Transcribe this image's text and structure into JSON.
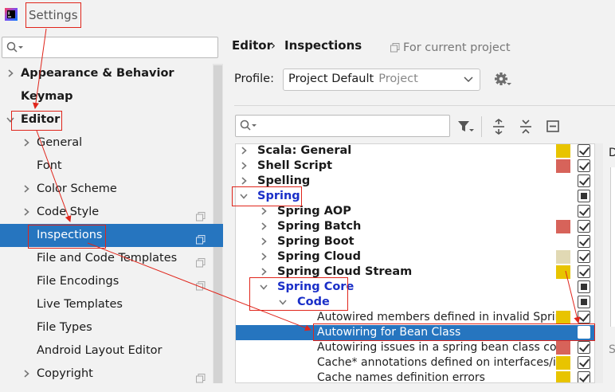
{
  "window": {
    "title": "Settings"
  },
  "sidebar": {
    "items": [
      {
        "label": "Appearance & Behavior",
        "expander": "collapsed",
        "bold": true,
        "indent": 0
      },
      {
        "label": "Keymap",
        "expander": "none",
        "bold": true,
        "indent": 0
      },
      {
        "label": "Editor",
        "expander": "expanded",
        "bold": true,
        "indent": 0
      },
      {
        "label": "General",
        "expander": "collapsed",
        "bold": false,
        "indent": 1
      },
      {
        "label": "Font",
        "expander": "none",
        "bold": false,
        "indent": 1
      },
      {
        "label": "Color Scheme",
        "expander": "collapsed",
        "bold": false,
        "indent": 1
      },
      {
        "label": "Code Style",
        "expander": "collapsed",
        "bold": false,
        "indent": 1,
        "project_icon": true
      },
      {
        "label": "Inspections",
        "expander": "none",
        "bold": false,
        "indent": 1,
        "selected": true,
        "project_icon": true
      },
      {
        "label": "File and Code Templates",
        "expander": "none",
        "bold": false,
        "indent": 1,
        "project_icon": true
      },
      {
        "label": "File Encodings",
        "expander": "none",
        "bold": false,
        "indent": 1,
        "project_icon": true
      },
      {
        "label": "Live Templates",
        "expander": "none",
        "bold": false,
        "indent": 1
      },
      {
        "label": "File Types",
        "expander": "none",
        "bold": false,
        "indent": 1
      },
      {
        "label": "Android Layout Editor",
        "expander": "none",
        "bold": false,
        "indent": 1
      },
      {
        "label": "Copyright",
        "expander": "collapsed",
        "bold": false,
        "indent": 1,
        "project_icon": true
      }
    ]
  },
  "breadcrumb": {
    "first": "Editor",
    "separator": "›",
    "second": "Inspections",
    "scope": "For current project"
  },
  "profile": {
    "label": "Profile:",
    "value": "Project Default",
    "scope": "Project"
  },
  "tree": {
    "rows": [
      {
        "label": "Scala: General",
        "expander": "collapsed",
        "bold": true,
        "indent": 0,
        "severity": "#e8c400",
        "check": "checked"
      },
      {
        "label": "Shell Script",
        "expander": "collapsed",
        "bold": true,
        "indent": 0,
        "severity": "#d7635a",
        "check": "checked"
      },
      {
        "label": "Spelling",
        "expander": "collapsed",
        "bold": true,
        "indent": 0,
        "severity": null,
        "check": "checked"
      },
      {
        "label": "Spring",
        "expander": "expanded",
        "bold": true,
        "blue": true,
        "indent": 0,
        "severity": null,
        "check": "partial"
      },
      {
        "label": "Spring AOP",
        "expander": "collapsed",
        "bold": true,
        "indent": 1,
        "severity": null,
        "check": "checked"
      },
      {
        "label": "Spring Batch",
        "expander": "collapsed",
        "bold": true,
        "indent": 1,
        "severity": "#d7635a",
        "check": "checked"
      },
      {
        "label": "Spring Boot",
        "expander": "collapsed",
        "bold": true,
        "indent": 1,
        "severity": null,
        "check": "checked"
      },
      {
        "label": "Spring Cloud",
        "expander": "collapsed",
        "bold": true,
        "indent": 1,
        "severity": "#e1d9b4",
        "check": "checked"
      },
      {
        "label": "Spring Cloud Stream",
        "expander": "collapsed",
        "bold": true,
        "indent": 1,
        "severity": "#e8c400",
        "check": "checked"
      },
      {
        "label": "Spring Core",
        "expander": "expanded",
        "bold": true,
        "blue": true,
        "indent": 1,
        "severity": null,
        "check": "partial"
      },
      {
        "label": "Code",
        "expander": "expanded",
        "bold": true,
        "blue": true,
        "indent": 2,
        "severity": null,
        "check": "partial"
      },
      {
        "label": "Autowired members defined in invalid Sprin",
        "expander": "none",
        "bold": false,
        "indent": 3,
        "severity": "#e8c400",
        "check": "checked"
      },
      {
        "label": "Autowiring for Bean Class",
        "expander": "none",
        "bold": false,
        "indent": 3,
        "severity": null,
        "check": "unchecked",
        "selected": true
      },
      {
        "label": "Autowiring issues in a spring bean class con",
        "expander": "none",
        "bold": false,
        "indent": 3,
        "severity": "#d7635a",
        "check": "checked"
      },
      {
        "label": "Cache* annotations defined on interfaces/in",
        "expander": "none",
        "bold": false,
        "indent": 3,
        "severity": "#e8c400",
        "check": "checked"
      },
      {
        "label": "Cache names definition errors",
        "expander": "none",
        "bold": false,
        "indent": 3,
        "severity": "#e8c400",
        "check": "checked"
      }
    ]
  },
  "description_pane": {
    "heading_letter": "D",
    "footer_letter": "S"
  },
  "colors": {
    "selection": "#2675bf",
    "annotation": "#e0251b",
    "group_label": "#1a2fc8"
  },
  "icons": {
    "app": "intellij-idea-icon",
    "search": "search-icon",
    "settings": "gear-icon",
    "filter": "filter-icon",
    "expand_all": "expand-all-icon",
    "collapse_all": "collapse-all-icon",
    "reset": "reset-icon",
    "project_scope": "project-scope-icon"
  }
}
